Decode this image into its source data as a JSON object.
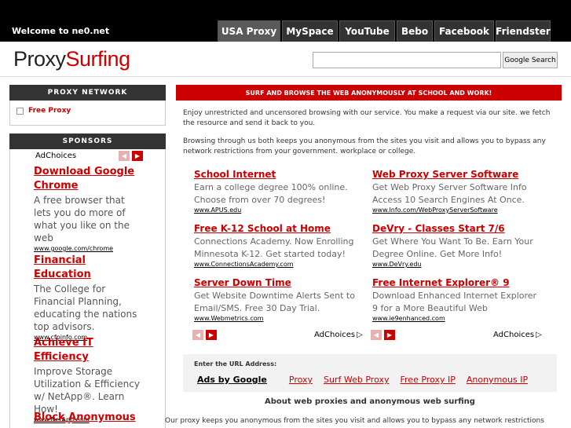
{
  "header": {
    "welcome": "Welcome to ne0.net",
    "tabs": [
      {
        "label": "USA Proxy",
        "active": true
      },
      {
        "label": "MySpace",
        "active": false
      },
      {
        "label": "YouTube",
        "active": false
      },
      {
        "label": "Bebo",
        "active": false
      },
      {
        "label": "Facebook",
        "active": false
      },
      {
        "label": "Friendster",
        "active": false
      }
    ]
  },
  "logo": {
    "part1": "Proxy",
    "part2": "Surfing"
  },
  "search": {
    "value": "",
    "button": "Google Search"
  },
  "sidebar": {
    "network_title": "PROXY NETWORK",
    "free_proxy": "Free Proxy",
    "sponsors_title": "SPONSORS",
    "adchoices": "AdChoices",
    "ads": [
      {
        "title": "Download Google Chrome",
        "desc": "A free browser that lets you do more of what you like on the web",
        "url": "www.google.com/chrome"
      },
      {
        "title": "Financial Education",
        "desc": "The College for Financial Planning, educating the nations top advisors.",
        "url": "www.cfpinfo.com"
      },
      {
        "title": "Achieve IT Efficiency",
        "desc": "Improve Storage Utilization & Efficiency w/ NetApp®. Learn How!",
        "url": "www.NetApp.com"
      },
      {
        "title": "Block Anonymous",
        "desc": "",
        "url": ""
      }
    ]
  },
  "main": {
    "banner": "SURF AND BROWSE THE WEB ANONYMOUSLY AT SCHOOL AND WORK!",
    "para1": "Enjoy unrestricted and uncensored browsing with our service. You make a request via our site. we fetch the resource and send it back to you.",
    "para2": "Browsing through us both keeps you anonymous from the sites you visit and allows you to bypass any network restrictions from your government. workplace or college.",
    "ads_left": [
      {
        "title": "School Internet",
        "desc": "Earn a college degree 100% online. Choose from over 70 degrees!",
        "url": "www.APUS.edu"
      },
      {
        "title": "Free K-12 School at Home",
        "desc": "Connections Academy. Now Enrolling Minnesota K-12. Get started today!",
        "url": "www.ConnectionsAcademy.com"
      },
      {
        "title": "Server Down Time",
        "desc": "Get Website Downtime Alerts Sent to Email/SMS. Free 30 Day Trial.",
        "url": "www.Webmetrics.com"
      }
    ],
    "ads_right": [
      {
        "title": "Web Proxy Server Software",
        "desc": "Get Web Proxy Server Software Info Access 10 Search Engines At Once.",
        "url": "www.Info.com/WebProxyServerSoftware"
      },
      {
        "title": "DeVry - Classes Start 7/6",
        "desc": "Get Where You Want To Be. Earn Your Degree Online. Get More Info!",
        "url": "www.DeVry.edu"
      },
      {
        "title": "Free Internet Explorer® 9",
        "desc": "Download Enhanced Internet Explorer 9 for a More Beautiful Web",
        "url": "www.ie9enhanced.com"
      }
    ],
    "adchoices": "AdChoices",
    "url_label": "Enter the URL Address:",
    "ads_by": "Ads by Google",
    "links": [
      "Proxy",
      "Surf Web Proxy",
      "Free Proxy IP",
      "Anonymous IP"
    ],
    "about_title": "About web proxies and anonymous web surfing",
    "bottom_text": "Our proxy keeps you anonymous from the sites you visit and allows you to bypass any network restrictions"
  }
}
